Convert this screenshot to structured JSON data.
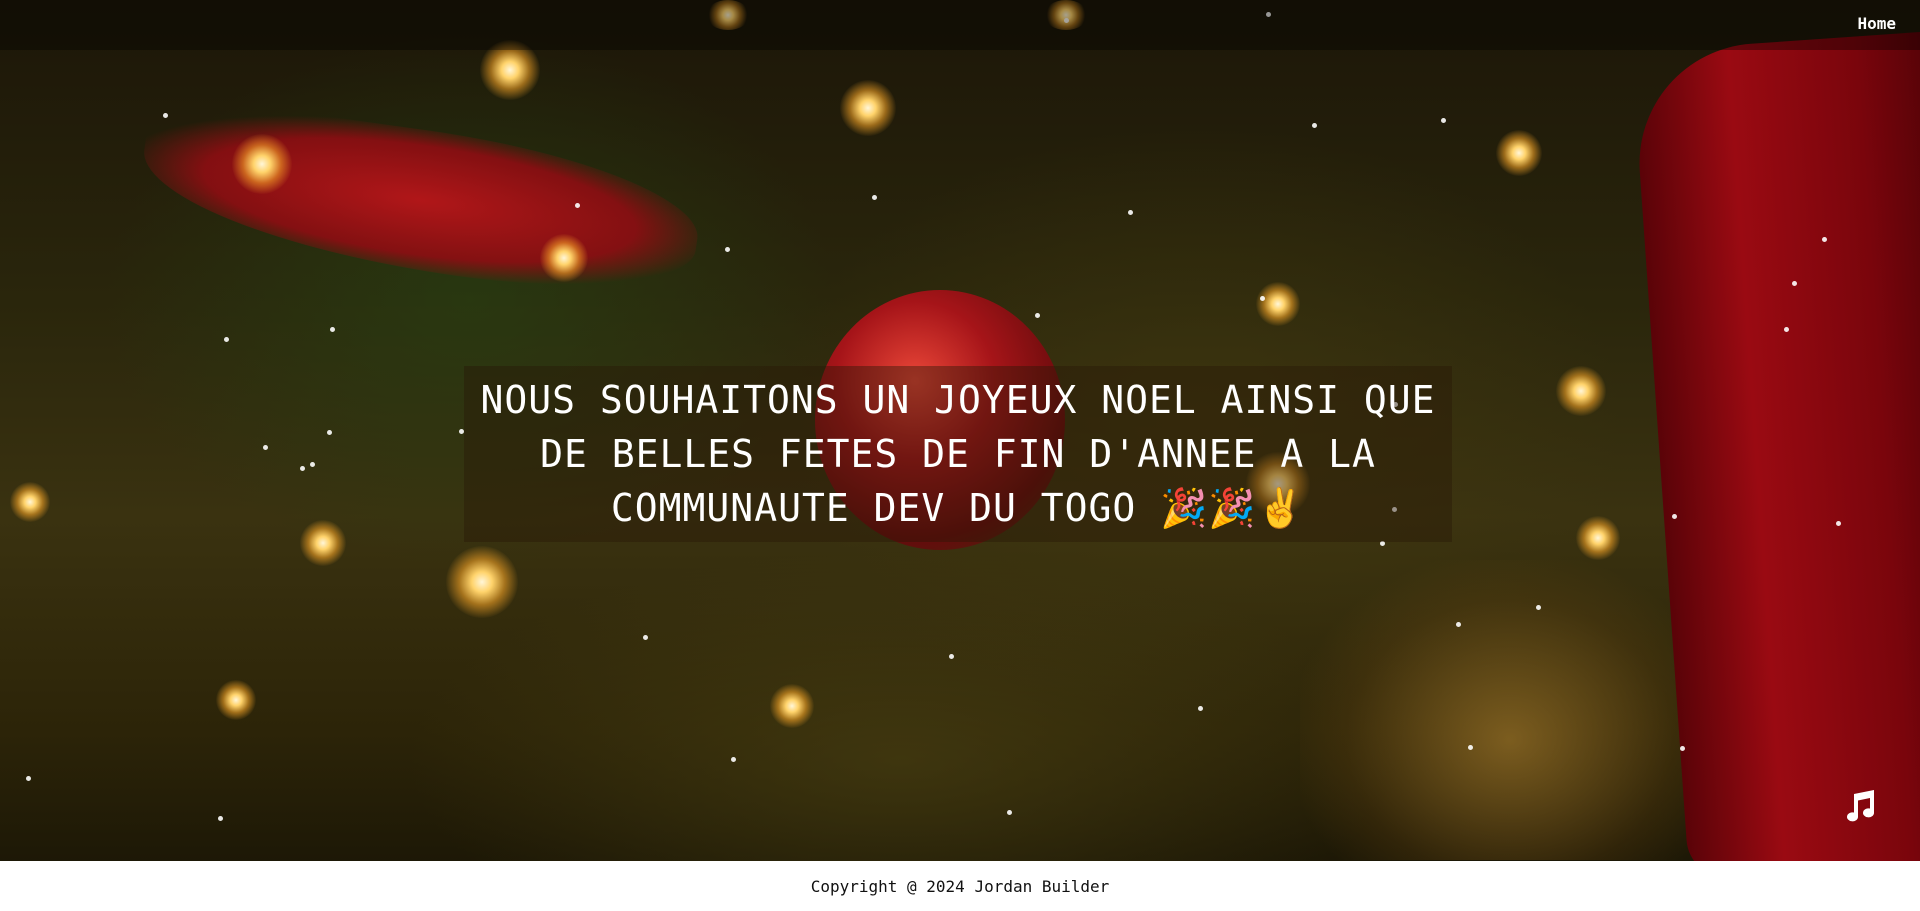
{
  "nav": {
    "home_label": "Home"
  },
  "hero": {
    "message": "NOUS SOUHAITONS UN JOYEUX NOEL AINSI QUE DE BELLES FETES DE FIN D'ANNEE A LA COMMUNAUTE DEV DU TOGO 🎉🎉✌️",
    "music_icon": "music-note-icon"
  },
  "footer": {
    "copyright": "Copyright @ 2024 Jordan Builder"
  },
  "colors": {
    "text": "#ffffff",
    "footer_text": "#111111",
    "accent_red": "#b3121a",
    "light_gold": "#ffd36b"
  }
}
